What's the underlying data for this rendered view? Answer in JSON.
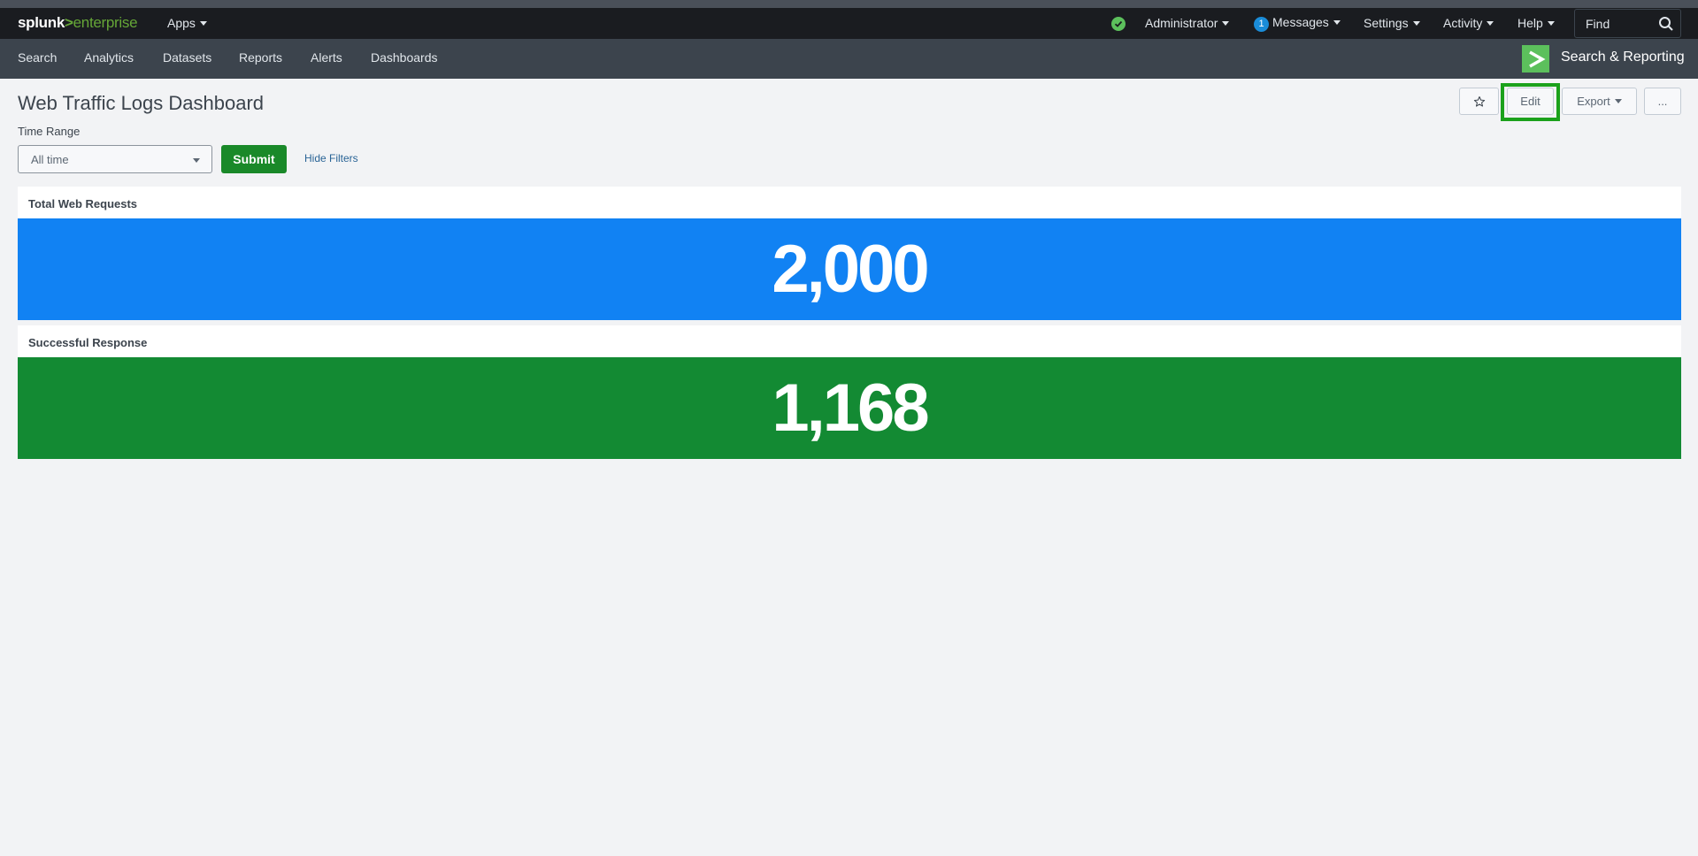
{
  "topbar": {
    "logo_part1": "splunk",
    "logo_part2": ">",
    "logo_part3": "enterprise",
    "apps_label": "Apps",
    "administrator_label": "Administrator",
    "messages_count": "1",
    "messages_label": "Messages",
    "settings_label": "Settings",
    "activity_label": "Activity",
    "help_label": "Help",
    "find_label": "Find"
  },
  "appbar": {
    "nav": [
      "Search",
      "Analytics",
      "Datasets",
      "Reports",
      "Alerts",
      "Dashboards"
    ],
    "app_title": "Search & Reporting"
  },
  "page": {
    "title": "Web Traffic Logs Dashboard",
    "star_icon": "star-icon",
    "edit_label": "Edit",
    "export_label": "Export",
    "more_label": "..."
  },
  "filters": {
    "time_range_label": "Time Range",
    "time_range_value": "All time",
    "submit_label": "Submit",
    "hide_filters_label": "Hide Filters"
  },
  "panels": [
    {
      "title": "Total Web Requests",
      "value": "2,000",
      "color": "#1182f3"
    },
    {
      "title": "Successful Response",
      "value": "1,168",
      "color": "#138a33"
    }
  ],
  "colors": {
    "accent_green": "#5cc05c",
    "submit_green": "#1a8929",
    "highlight_green": "#1ba11b"
  }
}
